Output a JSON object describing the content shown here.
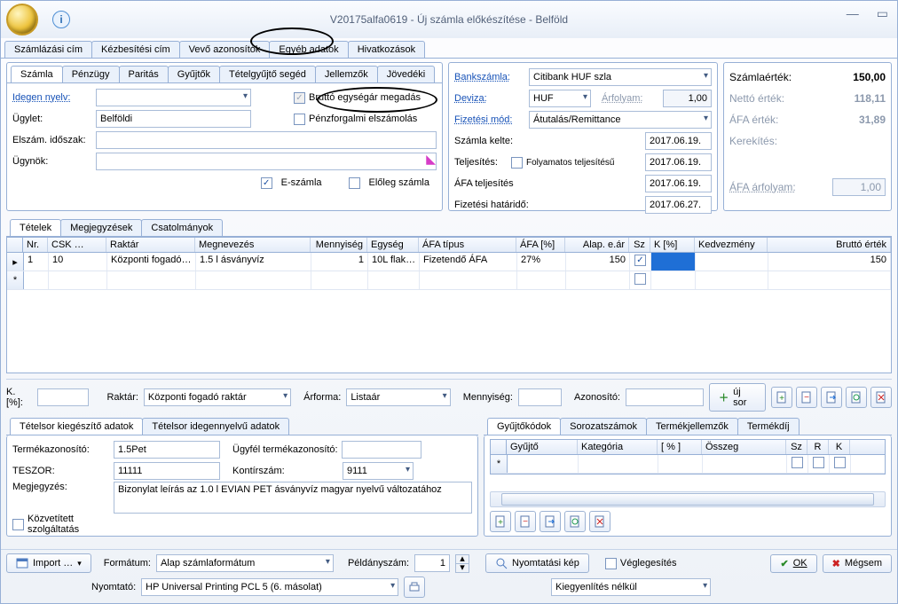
{
  "window": {
    "title": "V20175alfa0619 - Új számla előkészítése - Belföld"
  },
  "mainTabs": [
    "Számlázási cím",
    "Kézbesítési cím",
    "Vevő azonosítók",
    "Egyéb adatok",
    "Hivatkozások"
  ],
  "mainTabs_active": 3,
  "invoiceTabs": [
    "Számla",
    "Pénzügy",
    "Paritás",
    "Gyűjtők",
    "Tételgyűjtő segéd",
    "Jellemzők",
    "Jövedéki"
  ],
  "invoiceTabs_active": 0,
  "left": {
    "idegen_nyelv_label": "Idegen nyelv:",
    "idegen_nyelv_value": "",
    "ugylet_label": "Ügylet:",
    "ugylet_value": "Belföldi",
    "elszam_label": "Elszám. időszak:",
    "elszam_value": "",
    "ugynok_label": "Ügynök:",
    "ugynok_value": "",
    "brutto_label": "Bruttó egységár megadás",
    "brutto_checked": true,
    "penzforg_label": "Pénzforgalmi elszámolás",
    "penzforg_checked": false,
    "eszamla_label": "E-számla",
    "eszamla_checked": true,
    "eloleg_label": "Előleg számla",
    "eloleg_checked": false
  },
  "right": {
    "bankszamla_label": "Bankszámla:",
    "bankszamla_value": "Citibank HUF szla",
    "deviza_label": "Deviza:",
    "deviza_value": "HUF",
    "arfolyam_label": "Árfolyam:",
    "arfolyam_value": "1,00",
    "fizmod_label": "Fizetési mód:",
    "fizmod_value": "Átutalás/Remittance",
    "szamla_kelte_label": "Számla kelte:",
    "szamla_kelte_value": "2017.06.19.",
    "teljesites_label": "Teljesítés:",
    "folyamatos_label": "Folyamatos teljesítésű",
    "folyamatos_checked": false,
    "teljesites_value": "2017.06.19.",
    "afa_telj_label": "ÁFA teljesítés",
    "afa_telj_value": "2017.06.19.",
    "fiz_hat_label": "Fizetési határidő:",
    "fiz_hat_value": "2017.06.27."
  },
  "totals": {
    "szamlaertek_label": "Számlaérték:",
    "szamlaertek_value": "150,00",
    "netto_label": "Nettó érték:",
    "netto_value": "118,11",
    "afa_label": "ÁFA érték:",
    "afa_value": "31,89",
    "kerekites_label": "Kerekítés:",
    "kerekites_value": "",
    "afa_arf_label": "ÁFA árfolyam:",
    "afa_arf_value": "1,00"
  },
  "itemTabs": [
    "Tételek",
    "Megjegyzések",
    "Csatolmányok"
  ],
  "itemTabs_active": 0,
  "gridCols": [
    "",
    "Nr.",
    "CSK …",
    "Raktár",
    "Megnevezés",
    "Mennyiség",
    "Egység",
    "ÁFA típus",
    "ÁFA [%]",
    "Alap. e.ár",
    "Sz",
    "K [%]",
    "Kedvezmény",
    "Bruttó érték"
  ],
  "gridRow": {
    "nr": "1",
    "csk": "10",
    "raktar": "Központi fogadó…",
    "megnev": "1.5 l ásványvíz",
    "menny": "1",
    "egyseg": "10L flak…",
    "afatipus": "Fizetendő ÁFA",
    "afaszaz": "27%",
    "alapear": "150",
    "sz_checked": true,
    "kszaz": "",
    "kedv": "",
    "brutto": "150"
  },
  "quickbar": {
    "k_label": "K.[%]:",
    "k_value": "",
    "raktar_label": "Raktár:",
    "raktar_value": "Központi fogadó raktár",
    "arforma_label": "Árforma:",
    "arforma_value": "Listaár",
    "mennyiseg_label": "Mennyiség:",
    "mennyiseg_value": "",
    "azonosito_label": "Azonosító:",
    "azonosito_value": "",
    "ujsor_label": "új sor"
  },
  "supTabsLeft": [
    "Tételsor kiegészítő adatok",
    "Tételsor idegennyelvű adatok"
  ],
  "supTabsLeft_active": 0,
  "sup": {
    "termekaz_label": "Termékazonosító:",
    "termekaz_value": "1.5Pet",
    "ugyfel_termekaz_label": "Ügyfél termékazonosító:",
    "ugyfel_termekaz_value": "",
    "teszor_label": "TESZOR:",
    "teszor_value": "11111",
    "kontir_label": "Kontírszám:",
    "kontir_value": "9111",
    "megj_label": "Megjegyzés:",
    "megj_value": "Bizonylat leírás az 1.0 l EVIAN PET ásványvíz magyar nyelvű változatához",
    "kozv_label": "Közvetített szolgáltatás",
    "kozv_checked": false
  },
  "supTabsRight": [
    "Gyűjtőkódok",
    "Sorozatszámok",
    "Termékjellemzők",
    "Termékdíj"
  ],
  "supTabsRight_active": 0,
  "supGridCols": [
    "",
    "Gyűjtő",
    "Kategória",
    "[ % ]",
    "Összeg",
    "Sz",
    "R",
    "K"
  ],
  "bottom": {
    "import_label": "Import …",
    "formatum_label": "Formátum:",
    "formatum_value": "Alap számlaformátum",
    "peldanyszam_label": "Példányszám:",
    "peldanyszam_value": "1",
    "nyomtato_label": "Nyomtató:",
    "nyomtato_value": "HP Universal Printing PCL 5 (6. másolat)",
    "nyomtkep_label": "Nyomtatási kép",
    "veglegesites_label": "Véglegesítés",
    "veglegesites_checked": false,
    "kiegyen_value": "Kiegyenlítés nélkül",
    "ok_label": "OK",
    "megsem_label": "Mégsem"
  },
  "chart_data": null
}
